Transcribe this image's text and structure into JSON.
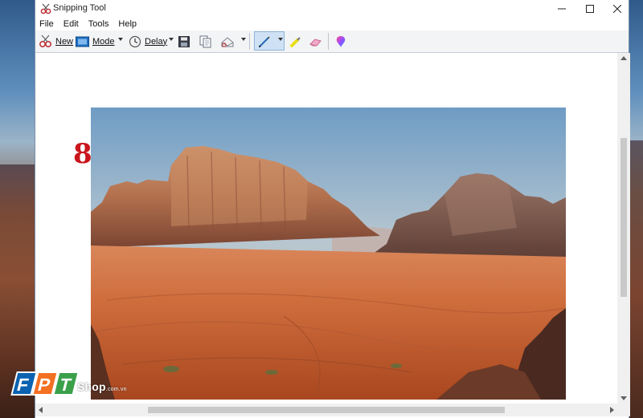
{
  "window": {
    "title": "Snipping Tool",
    "controls": {
      "minimize": "—",
      "maximize": "☐",
      "close": "✕"
    }
  },
  "menu": [
    "File",
    "Edit",
    "Tools",
    "Help"
  ],
  "toolbar": {
    "new_label": "New",
    "mode_label": "Mode",
    "delay_label": "Delay",
    "icons": [
      "new-snip-icon",
      "mode-icon",
      "delay-clock-icon",
      "save-icon",
      "copy-icon",
      "send-email-icon",
      "pen-icon",
      "highlighter-icon",
      "eraser-icon",
      "paint3d-icon"
    ],
    "active_tool": "pen"
  },
  "canvas": {
    "step_number": "8",
    "image_subject": "desert-rock-formations"
  },
  "watermark": {
    "brand": "FPT",
    "shop": "Shop",
    "domain": ".com.vn"
  },
  "colors": {
    "step_number": "#c9151c",
    "pen_active_bg": "#cfe2f5",
    "brand_blue": "#0a62b0",
    "brand_orange": "#f36f21",
    "brand_green": "#3aa04a"
  }
}
